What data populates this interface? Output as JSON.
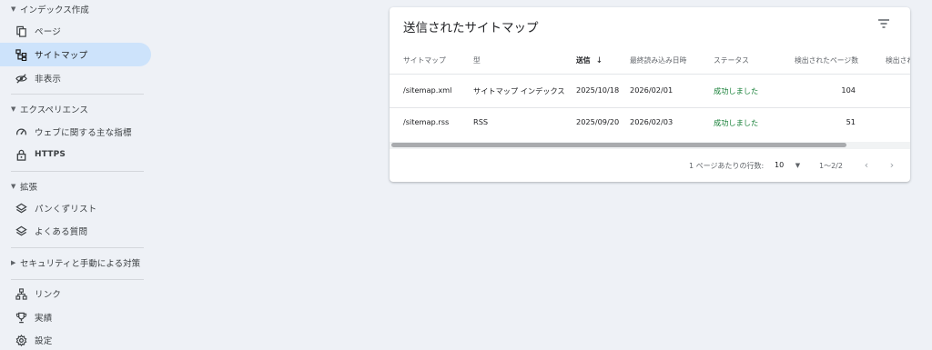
{
  "sidebar": {
    "section_index": "インデックス作成",
    "item_pages": "ページ",
    "item_sitemaps": "サイトマップ",
    "item_removals": "非表示",
    "section_experience": "エクスペリエンス",
    "item_cwv": "ウェブに関する主な指標",
    "item_https": "HTTPS",
    "section_enhancements": "拡張",
    "item_breadcrumbs": "パンくずリスト",
    "item_faq": "よくある質問",
    "section_security": "セキュリティと手動による対策",
    "item_links": "リンク",
    "item_achievements": "実績",
    "item_settings": "設定"
  },
  "card": {
    "title": "送信されたサイトマップ",
    "columns": {
      "sitemap": "サイトマップ",
      "type": "型",
      "submitted": "送信",
      "last_read": "最終読み込み日時",
      "status": "ステータス",
      "discovered_pages": "検出されたページ数",
      "discovered_more": "検出され"
    },
    "rows": [
      {
        "sitemap": "/sitemap.xml",
        "type": "サイトマップ インデックス",
        "submitted": "2025/10/18",
        "last_read": "2026/02/01",
        "status": "成功しました",
        "pages": "104"
      },
      {
        "sitemap": "/sitemap.rss",
        "type": "RSS",
        "submitted": "2025/09/20",
        "last_read": "2026/02/03",
        "status": "成功しました",
        "pages": "51"
      }
    ],
    "footer": {
      "rows_per_page_label": "1 ページあたりの行数:",
      "rows_per_page_value": "10",
      "range": "1〜2/2"
    }
  },
  "colors": {
    "background": "#eef1f6",
    "active_item": "#cde3fb",
    "success": "#188038"
  },
  "icons": {
    "pages": "pages-icon",
    "sitemaps": "sitemap-icon",
    "removals": "eye-off-icon",
    "cwv": "speed-gauge-icon",
    "https": "lock-icon",
    "breadcrumbs": "layers-icon",
    "faq": "layers-icon",
    "links": "network-icon",
    "achievements": "trophy-icon",
    "settings": "gear-icon",
    "filter": "filter-icon",
    "sort": "arrow-down-icon"
  }
}
